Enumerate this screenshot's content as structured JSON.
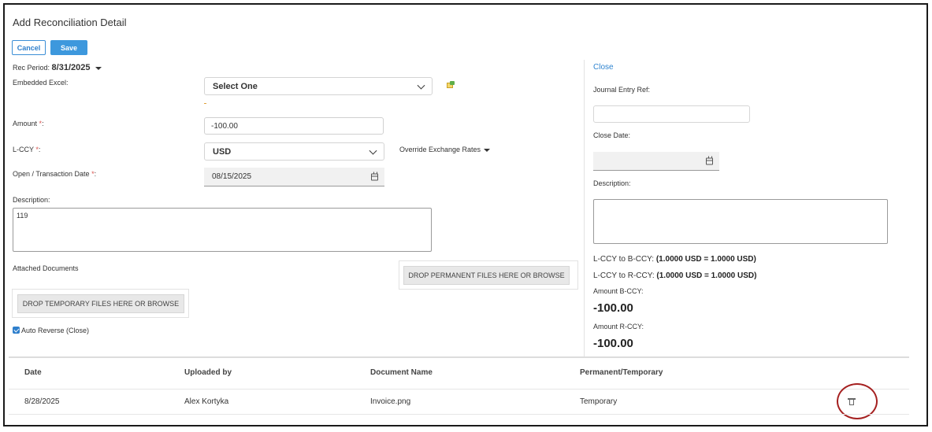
{
  "header": {
    "title": "Add Reconciliation Detail"
  },
  "toolbar": {
    "cancel_label": "Cancel",
    "save_label": "Save"
  },
  "form": {
    "rec_period_label": "Rec Period:",
    "rec_period_value": "8/31/2025",
    "embedded_excel_label": "Embedded Excel:",
    "embedded_excel_value": "Select One",
    "amount_label": "Amount",
    "amount_value": "-100.00",
    "lccy_label": "L-CCY",
    "lccy_value": "USD",
    "override_rates_label": "Override Exchange Rates",
    "open_date_label": "Open / Transaction Date",
    "open_date_value": "08/15/2025",
    "description_label": "Description:",
    "description_value": "119",
    "attached_documents_label": "Attached Documents",
    "drop_permanent_label": "DROP PERMANENT FILES HERE OR BROWSE",
    "drop_temporary_label": "DROP TEMPORARY FILES HERE OR BROWSE",
    "auto_reverse_label": "Auto Reverse (Close)",
    "required_mark": "*",
    "label_colon": ":"
  },
  "close_panel": {
    "close_link": "Close",
    "journal_ref_label": "Journal Entry Ref:",
    "journal_ref_value": "",
    "close_date_label": "Close Date:",
    "close_date_value": "",
    "description_label": "Description:",
    "description_value": "",
    "lccy_to_bccy_label": "L-CCY to B-CCY:",
    "lccy_to_bccy_value": "(1.0000 USD = 1.0000 USD)",
    "lccy_to_rccy_label": "L-CCY to R-CCY:",
    "lccy_to_rccy_value": "(1.0000 USD = 1.0000 USD)",
    "amount_bccy_label": "Amount B-CCY:",
    "amount_bccy_value": "-100.00",
    "amount_rccy_label": "Amount R-CCY:",
    "amount_rccy_value": "-100.00"
  },
  "documents_table": {
    "columns": [
      "Date",
      "Uploaded by",
      "Document Name",
      "Permanent/Temporary"
    ],
    "rows": [
      {
        "date": "8/28/2025",
        "uploaded_by": "Alex Kortyka",
        "document_name": "Invoice.png",
        "type": "Temporary"
      }
    ]
  },
  "colors": {
    "accent": "#3d98dd",
    "link": "#2f84d0",
    "required": "#d9534f",
    "highlight_circle": "#a52020"
  },
  "icons": [
    "chevron-down-icon",
    "excel-icon",
    "calendar-icon",
    "checkbox-icon",
    "trash-icon",
    "caret-down-icon"
  ]
}
